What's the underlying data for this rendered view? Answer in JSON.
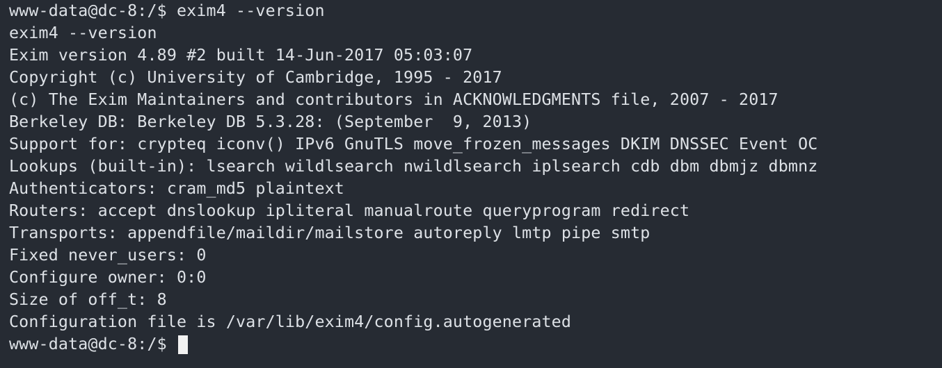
{
  "terminal": {
    "prompt": "www-data@dc-8:/$ ",
    "command": "exim4 --version",
    "output": [
      "exim4 --version",
      "Exim version 4.89 #2 built 14-Jun-2017 05:03:07",
      "Copyright (c) University of Cambridge, 1995 - 2017",
      "(c) The Exim Maintainers and contributors in ACKNOWLEDGMENTS file, 2007 - 2017",
      "Berkeley DB: Berkeley DB 5.3.28: (September  9, 2013)",
      "Support for: crypteq iconv() IPv6 GnuTLS move_frozen_messages DKIM DNSSEC Event OC",
      "Lookups (built-in): lsearch wildlsearch nwildlsearch iplsearch cdb dbm dbmjz dbmnz",
      "Authenticators: cram_md5 plaintext",
      "Routers: accept dnslookup ipliteral manualroute queryprogram redirect",
      "Transports: appendfile/maildir/mailstore autoreply lmtp pipe smtp",
      "Fixed never_users: 0",
      "Configure owner: 0:0",
      "Size of off_t: 8",
      "Configuration file is /var/lib/exim4/config.autogenerated"
    ],
    "final_prompt": "www-data@dc-8:/$ "
  }
}
